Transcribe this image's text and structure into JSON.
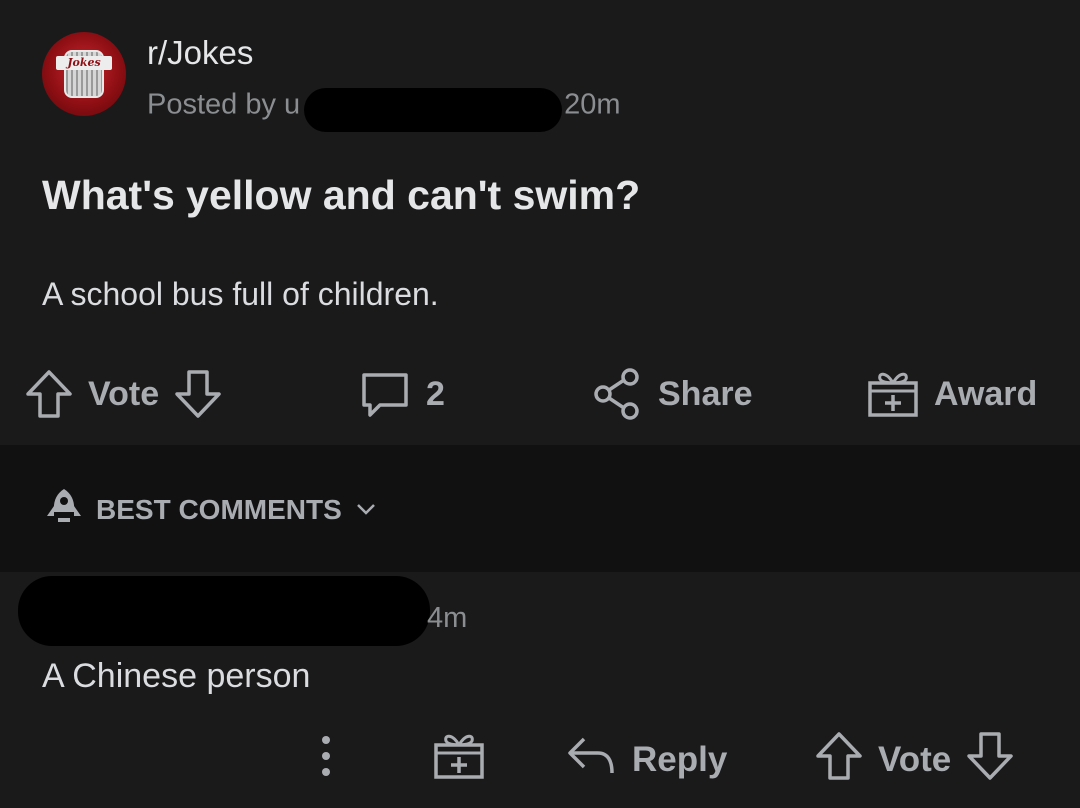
{
  "post": {
    "subreddit": "r/Jokes",
    "avatar_label": "Jokes",
    "posted_by_prefix": "Posted by u",
    "age": "20m",
    "title": "What's yellow and can't swim?",
    "body": "A school bus full of children."
  },
  "post_actions": {
    "vote_label": "Vote",
    "comment_count": "2",
    "share_label": "Share",
    "award_label": "Award"
  },
  "comments_header": {
    "sort_label": "BEST COMMENTS"
  },
  "comment": {
    "age": "4m",
    "body": "A Chinese person",
    "reply_label": "Reply",
    "vote_label": "Vote"
  },
  "colors": {
    "background": "#1a1a1b",
    "band": "#111112",
    "text": "#d7dadc",
    "muted": "#8b8e91",
    "redaction": "#000000"
  }
}
